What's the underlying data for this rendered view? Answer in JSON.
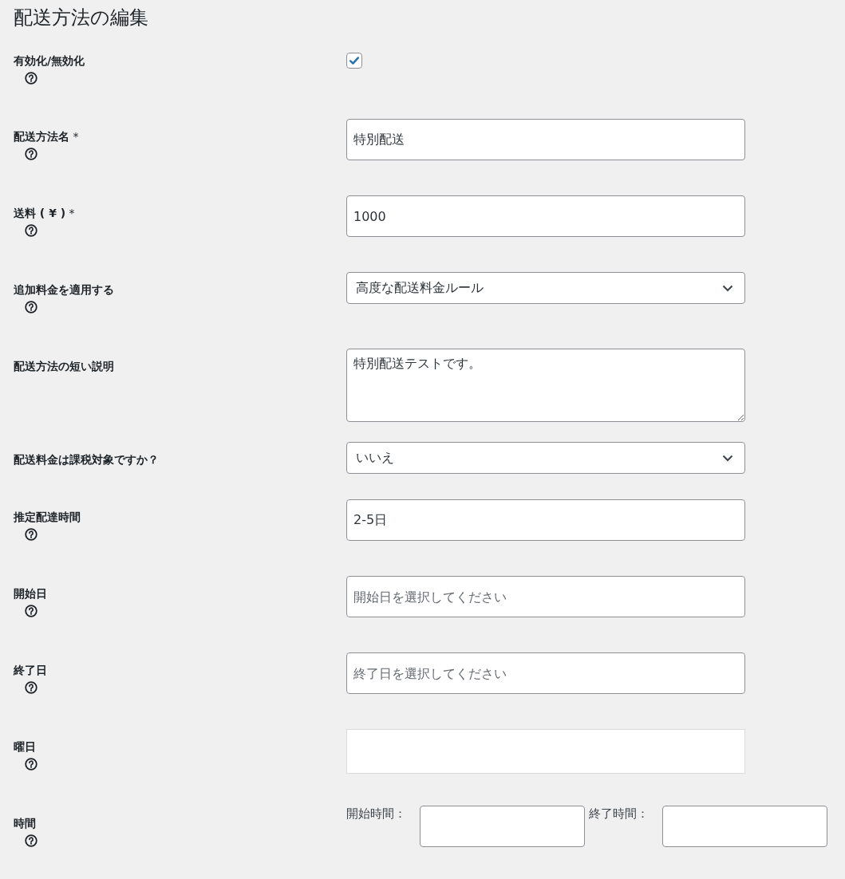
{
  "title": "配送方法の編集",
  "fields": [
    {
      "kind": "checkbox",
      "label": "有効化/無効化",
      "help": true,
      "checked": true
    },
    {
      "kind": "text",
      "label": "配送方法名",
      "required_mark": "*",
      "help": true,
      "value": "特別配送"
    },
    {
      "kind": "text",
      "label": "送料 ( ¥ )",
      "required_mark": "*",
      "help": true,
      "value": "1000"
    },
    {
      "kind": "select",
      "label": "追加料金を適用する",
      "help": true,
      "value": "高度な配送料金ルール"
    },
    {
      "kind": "textarea",
      "label": "配送方法の短い説明",
      "help": false,
      "value": "特別配送テストです。"
    },
    {
      "kind": "select",
      "label": "配送料金は課税対象ですか？",
      "help": false,
      "value": "いいえ"
    },
    {
      "kind": "text",
      "label": "推定配達時間",
      "help": true,
      "value": "2-5日"
    },
    {
      "kind": "text",
      "label": "開始日",
      "help": true,
      "placeholder": "開始日を選択してください"
    },
    {
      "kind": "text",
      "label": "終了日",
      "help": true,
      "placeholder": "終了日を選択してください"
    },
    {
      "kind": "multiselect",
      "label": "曜日",
      "help": true
    },
    {
      "kind": "timerange",
      "label": "時間",
      "help": true,
      "start_label": "開始時間：",
      "end_label": "終了時間："
    }
  ]
}
